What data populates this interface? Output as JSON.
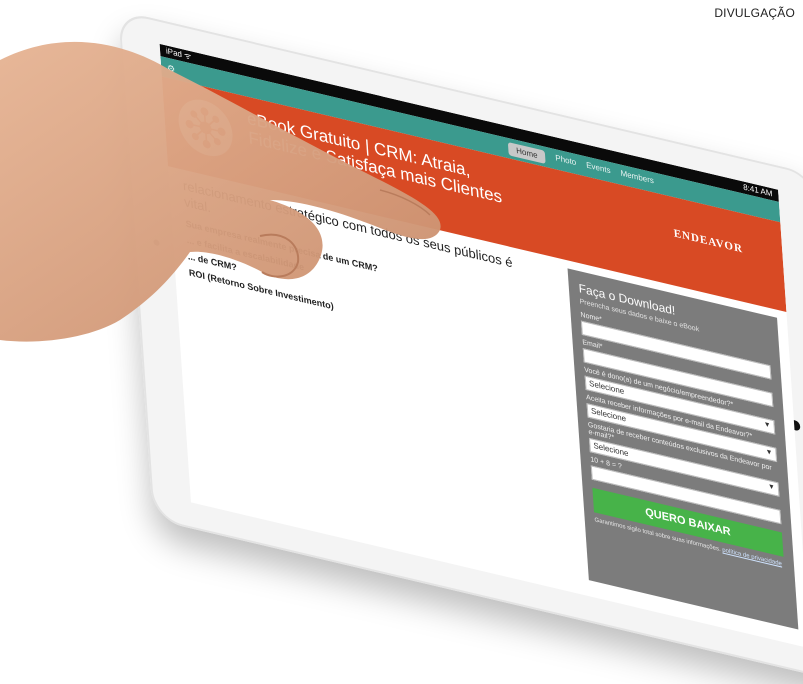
{
  "credit": "DIVULGAÇÃO",
  "statusbar": {
    "left": "iPad ᯤ",
    "time": "8:41 AM"
  },
  "browser": {
    "tabs": [
      {
        "label": "Home",
        "active": true
      },
      {
        "label": "Photo"
      },
      {
        "label": "Events"
      },
      {
        "label": "Members"
      }
    ]
  },
  "header": {
    "headline": "eBook Gratuito | CRM: Atraia, Fidelize e Satisfaça mais Clientes",
    "partner_logo": "ENDEAVOR",
    "accent_color": "#d84a24"
  },
  "content": {
    "intro": "relacionamento estratégico com todos os seus públicos é vital.",
    "items": [
      {
        "question": "Sua empresa realmente precisa de um CRM?",
        "answer": ""
      },
      {
        "question": "... e facilita a escalabilidade",
        "answer": ""
      },
      {
        "question": "... de CRM?",
        "answer": ""
      },
      {
        "question": "ROI (Retorno Sobre Investimento)",
        "answer": ""
      }
    ]
  },
  "form": {
    "title": "Faça o Download!",
    "subtitle": "Preencha seus dados e baixe o eBook",
    "fields": [
      {
        "label": "Nome*"
      },
      {
        "label": "Email*"
      },
      {
        "label": "Você é dono(a) de um negócio/empreendedor?*",
        "value": "Selecione"
      },
      {
        "label": "Aceita receber informações por e-mail da Endeavor?*",
        "value": "Selecione"
      },
      {
        "label": "Gostaria de receber conteúdos exclusivos da Endeavor por e-mail?*",
        "value": "Selecione"
      },
      {
        "label": "10 + 8 = ?"
      }
    ],
    "submit_label": "QUERO BAIXAR",
    "disclaimer": "Garantimos sigilo total sobre suas informações.",
    "disclaimer_link": "política de privacidade",
    "button_color": "#47b349",
    "panel_color": "#7c7c7c"
  }
}
